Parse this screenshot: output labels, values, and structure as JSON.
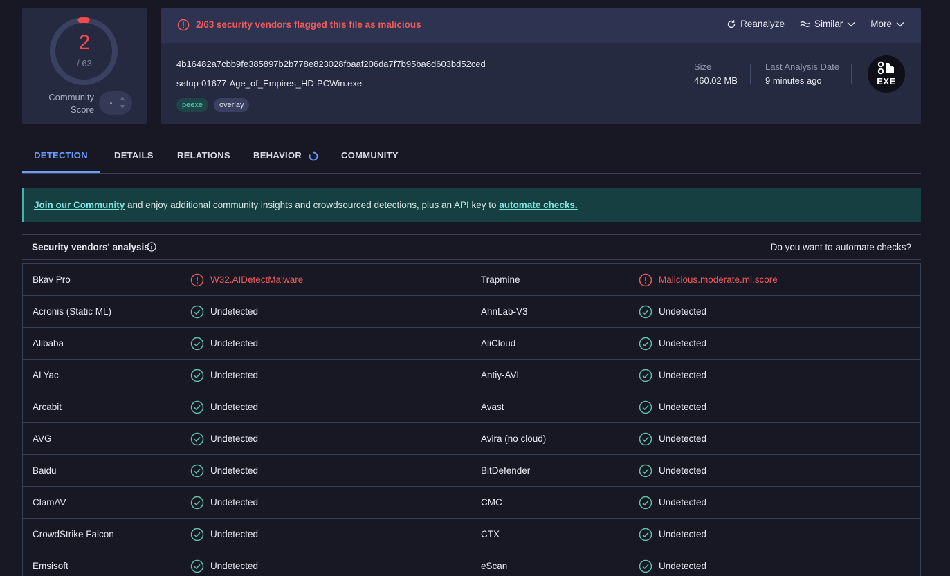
{
  "score": {
    "detected": "2",
    "total": "/ 63",
    "label_line1": "Community",
    "label_line2": "Score",
    "detected_fraction": 0.032
  },
  "banner": {
    "flag_text": "2/63 security vendors flagged this file as malicious"
  },
  "actions": {
    "reanalyze": "Reanalyze",
    "similar": "Similar",
    "more": "More"
  },
  "file": {
    "hash": "4b16482a7cbb9fe385897b2b778e823028fbaaf206da7f7b95ba6d603bd52ced",
    "name": "setup-01677-Age_of_Empires_HD-PCWin.exe",
    "tags": [
      "peexe",
      "overlay"
    ],
    "size_label": "Size",
    "size_value": "460.02 MB",
    "date_label": "Last Analysis Date",
    "date_value": "9 minutes ago",
    "type_badge": "EXE"
  },
  "tabs": [
    "DETECTION",
    "DETAILS",
    "RELATIONS",
    "BEHAVIOR",
    "COMMUNITY"
  ],
  "join": {
    "link1": "Join our Community",
    "middle": " and enjoy additional community insights and crowdsourced detections, plus an API key to ",
    "link2": "automate checks."
  },
  "vendors_section": {
    "title": "Security vendors' analysis",
    "automate_question": "Do you want to automate checks?"
  },
  "colors": {
    "malicious": "#ef5a5a",
    "clean": "#5fc2a8",
    "accent": "#6d9cff"
  },
  "vendors": [
    [
      {
        "name": "Bkav Pro",
        "result": "W32.AIDetectMalware",
        "malicious": true
      },
      {
        "name": "Trapmine",
        "result": "Malicious.moderate.ml.score",
        "malicious": true
      }
    ],
    [
      {
        "name": "Acronis (Static ML)",
        "result": "Undetected",
        "malicious": false
      },
      {
        "name": "AhnLab-V3",
        "result": "Undetected",
        "malicious": false
      }
    ],
    [
      {
        "name": "Alibaba",
        "result": "Undetected",
        "malicious": false
      },
      {
        "name": "AliCloud",
        "result": "Undetected",
        "malicious": false
      }
    ],
    [
      {
        "name": "ALYac",
        "result": "Undetected",
        "malicious": false
      },
      {
        "name": "Antiy-AVL",
        "result": "Undetected",
        "malicious": false
      }
    ],
    [
      {
        "name": "Arcabit",
        "result": "Undetected",
        "malicious": false
      },
      {
        "name": "Avast",
        "result": "Undetected",
        "malicious": false
      }
    ],
    [
      {
        "name": "AVG",
        "result": "Undetected",
        "malicious": false
      },
      {
        "name": "Avira (no cloud)",
        "result": "Undetected",
        "malicious": false
      }
    ],
    [
      {
        "name": "Baidu",
        "result": "Undetected",
        "malicious": false
      },
      {
        "name": "BitDefender",
        "result": "Undetected",
        "malicious": false
      }
    ],
    [
      {
        "name": "ClamAV",
        "result": "Undetected",
        "malicious": false
      },
      {
        "name": "CMC",
        "result": "Undetected",
        "malicious": false
      }
    ],
    [
      {
        "name": "CrowdStrike Falcon",
        "result": "Undetected",
        "malicious": false
      },
      {
        "name": "CTX",
        "result": "Undetected",
        "malicious": false
      }
    ],
    [
      {
        "name": "Emsisoft",
        "result": "Undetected",
        "malicious": false
      },
      {
        "name": "eScan",
        "result": "Undetected",
        "malicious": false
      }
    ]
  ]
}
